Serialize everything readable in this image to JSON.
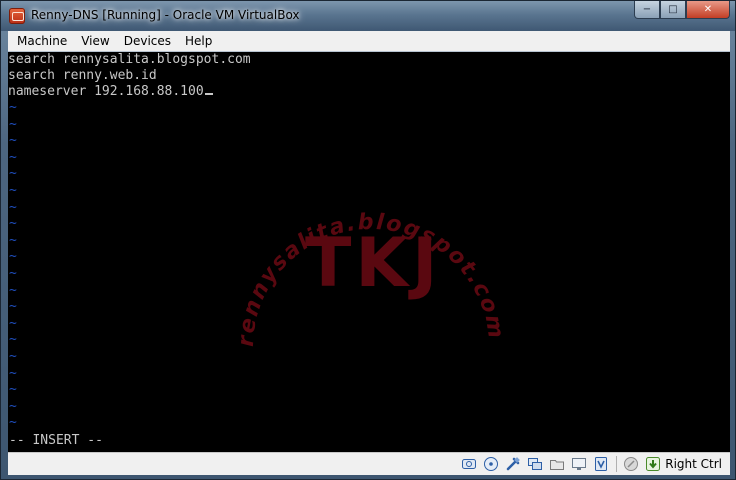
{
  "window": {
    "title": "Renny-DNS [Running] - Oracle VM VirtualBox",
    "controls": {
      "minimize": "−",
      "maximize": "□",
      "close": "✕"
    }
  },
  "menu": {
    "items": [
      {
        "label": "Machine"
      },
      {
        "label": "View"
      },
      {
        "label": "Devices"
      },
      {
        "label": "Help"
      }
    ]
  },
  "terminal": {
    "lines": [
      "search rennysalita.blogspot.com",
      "search renny.web.id",
      "nameserver 192.168.88.100"
    ],
    "tilde_char": "~",
    "mode_line": "-- INSERT --",
    "watermark_arc_text": "rennysalita.blogspot.com",
    "watermark_center": "TKJ",
    "watermark_color": "#5a0810",
    "tilde_color": "#1f4fbf"
  },
  "statusbar": {
    "icons": [
      {
        "name": "hard-disk-icon"
      },
      {
        "name": "optical-drive-icon"
      },
      {
        "name": "usb-icon"
      },
      {
        "name": "network-icon"
      },
      {
        "name": "shared-folders-icon"
      },
      {
        "name": "display-icon"
      },
      {
        "name": "virtualization-icon"
      },
      {
        "name": "mouse-integration-icon"
      },
      {
        "name": "keyboard-capture-icon"
      }
    ],
    "host_key_label": "Right Ctrl"
  }
}
